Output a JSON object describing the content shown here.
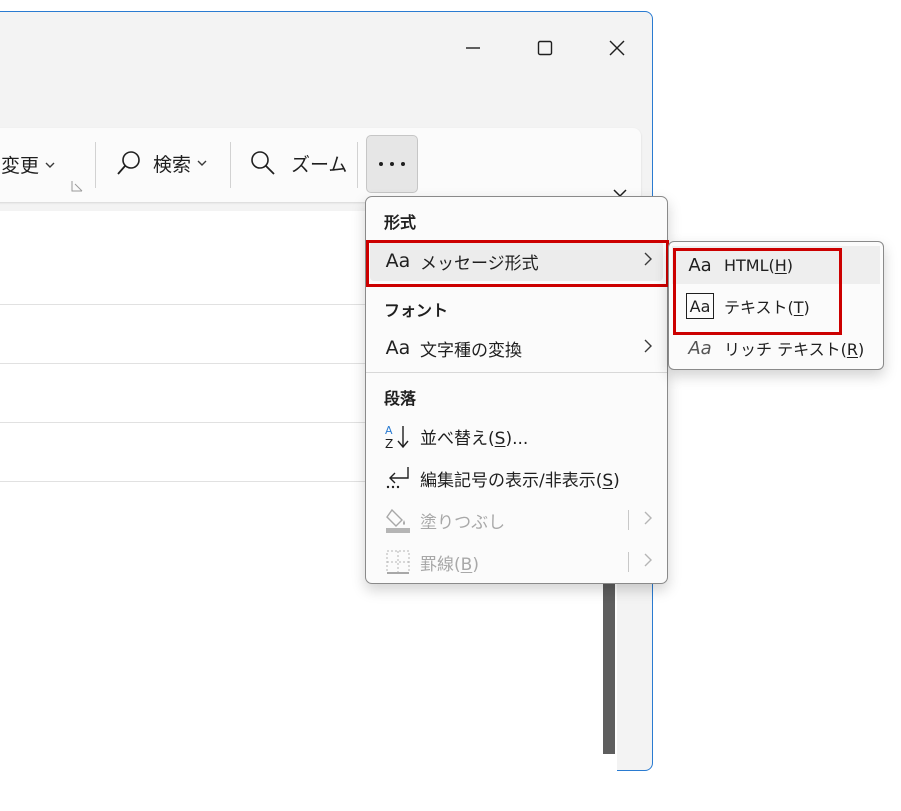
{
  "ribbon": {
    "change_label": "変更",
    "search_label": "検索",
    "zoom_label": "ズーム",
    "more_label": "…"
  },
  "menu": {
    "format_header": "形式",
    "message_format": "メッセージ形式",
    "font_header": "フォント",
    "change_case": "文字種の変換",
    "paragraph_header": "段落",
    "sort_pre": "並べ替え(",
    "sort_key": "S",
    "sort_post": ")...",
    "show_marks_pre": "編集記号の表示/非表示(",
    "show_marks_key": "S",
    "show_marks_post": ")",
    "shading": "塗りつぶし",
    "borders_pre": "罫線(",
    "borders_key": "B",
    "borders_post": ")"
  },
  "submenu": {
    "html_pre": "HTML(",
    "html_key": "H",
    "html_post": ")",
    "text_pre": "テキスト(",
    "text_key": "T",
    "text_post": ")",
    "rich_pre": "リッチ テキスト(",
    "rich_key": "R",
    "rich_post": ")"
  },
  "icons": {
    "font_glyph": "Aa"
  },
  "colors": {
    "highlight": "#cc0000",
    "window_border": "#2a7bd1"
  }
}
